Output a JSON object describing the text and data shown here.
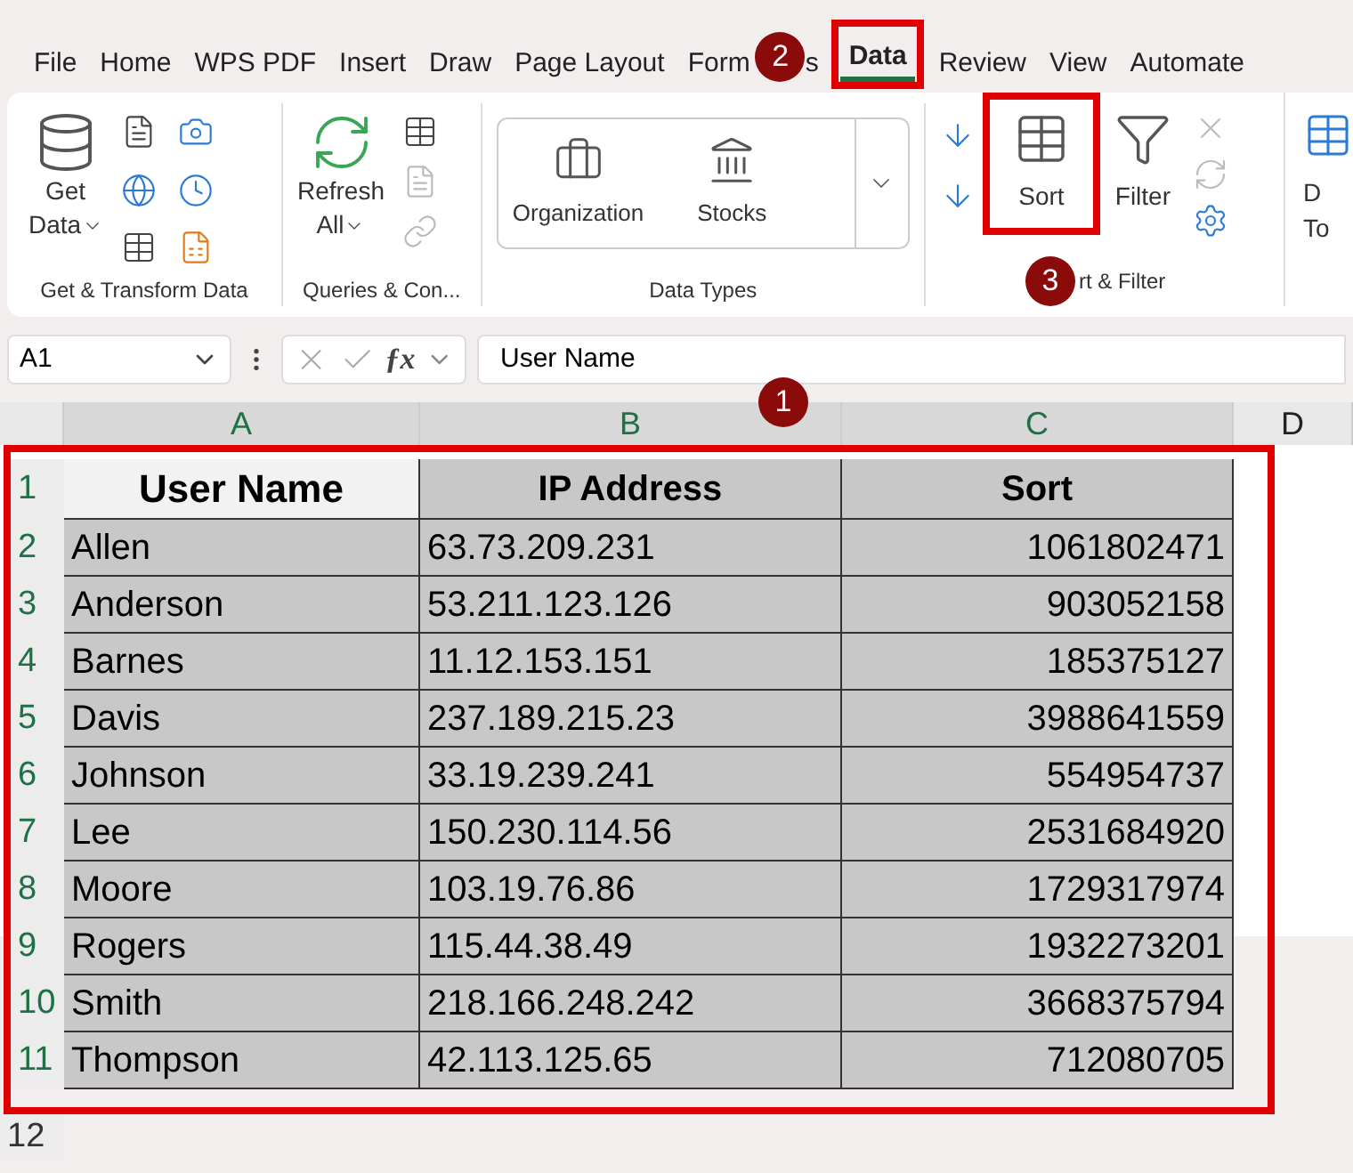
{
  "tabs": [
    {
      "label": "File",
      "selected": false
    },
    {
      "label": "Home",
      "selected": false
    },
    {
      "label": "WPS PDF",
      "selected": false
    },
    {
      "label": "Insert",
      "selected": false
    },
    {
      "label": "Draw",
      "selected": false
    },
    {
      "label": "Page Layout",
      "selected": false
    },
    {
      "label": "Form",
      "label_tail": "s",
      "selected": false
    },
    {
      "label": "Data",
      "selected": true
    },
    {
      "label": "Review",
      "selected": false
    },
    {
      "label": "View",
      "selected": false
    },
    {
      "label": "Automate",
      "selected": false
    }
  ],
  "ribbon": {
    "get_data": {
      "label": "Get",
      "label2": "Data"
    },
    "get_transform_label": "Get & Transform Data",
    "refresh": {
      "label": "Refresh",
      "label2": "All"
    },
    "queries_label": "Queries & Con...",
    "data_types": [
      "Organization",
      "Stocks"
    ],
    "data_types_label": "Data Types",
    "sort": "Sort",
    "filter": "Filter",
    "sort_filter_label": "rt & Filter",
    "data_tools": {
      "label": "D",
      "label2": "To"
    }
  },
  "formula_bar": {
    "name_box": "A1",
    "fx_label": "ƒx",
    "value": "User Name"
  },
  "columns": [
    "A",
    "B",
    "C",
    "D"
  ],
  "rows": [
    {
      "number": "1",
      "cells": [
        "User Name",
        "IP Address",
        "Sort"
      ]
    },
    {
      "number": "2",
      "cells": [
        "Allen",
        "63.73.209.231",
        "1061802471"
      ]
    },
    {
      "number": "3",
      "cells": [
        "Anderson",
        "53.211.123.126",
        "903052158"
      ]
    },
    {
      "number": "4",
      "cells": [
        "Barnes",
        "11.12.153.151",
        "185375127"
      ]
    },
    {
      "number": "5",
      "cells": [
        "Davis",
        "237.189.215.23",
        "3988641559"
      ]
    },
    {
      "number": "6",
      "cells": [
        "Johnson",
        "33.19.239.241",
        "554954737"
      ]
    },
    {
      "number": "7",
      "cells": [
        "Lee",
        "150.230.114.56",
        "2531684920"
      ]
    },
    {
      "number": "8",
      "cells": [
        "Moore",
        "103.19.76.86",
        "1729317974"
      ]
    },
    {
      "number": "9",
      "cells": [
        "Rogers",
        "115.44.38.49",
        "1932273201"
      ]
    },
    {
      "number": "10",
      "cells": [
        "Smith",
        "218.166.248.242",
        "3668375794"
      ]
    },
    {
      "number": "11",
      "cells": [
        "Thompson",
        "42.113.125.65",
        "712080705"
      ]
    },
    {
      "number": "12",
      "cells": []
    }
  ],
  "callouts": [
    "1",
    "2",
    "3"
  ]
}
